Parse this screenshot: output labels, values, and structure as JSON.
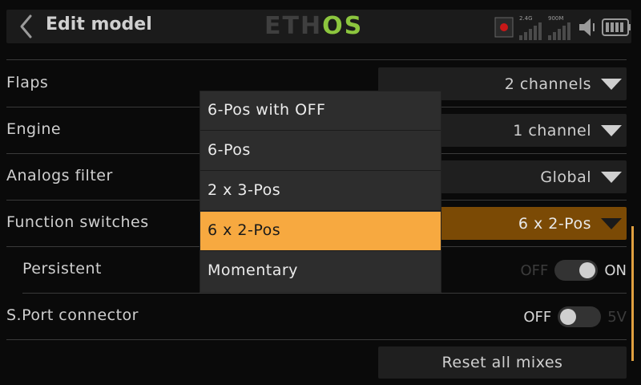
{
  "header": {
    "title": "Edit model",
    "logo_left": "ETH",
    "logo_right": "OS",
    "radio_band": "2.4G",
    "radio_freq": "900M"
  },
  "rows": [
    {
      "label": "Flaps",
      "value": "2 channels"
    },
    {
      "label": "Engine",
      "value": "1 channel"
    },
    {
      "label": "Analogs filter",
      "value": "Global"
    },
    {
      "label": "Function switches",
      "value": "6 x 2-Pos"
    },
    {
      "label": "Persistent",
      "toggle_off": "OFF",
      "toggle_on": "ON",
      "state": "on"
    },
    {
      "label": "S.Port connector",
      "toggle_off": "OFF",
      "toggle_on": "5V",
      "state": "off"
    }
  ],
  "reset_button": "Reset all mixes",
  "dropdown": {
    "options": [
      "6-Pos with OFF",
      "6-Pos",
      "2 x 3-Pos",
      "6 x 2-Pos",
      "Momentary"
    ],
    "selected": "6 x 2-Pos"
  },
  "colors": {
    "accent": "#f7a940",
    "active_select": "#7b4a05",
    "logo_green": "#8cc63e"
  },
  "icons": {
    "back": "chevron-left-icon",
    "record": "record-icon",
    "signal": "signal-bars-icon",
    "volume": "speaker-icon",
    "battery": "battery-icon",
    "dropdown": "caret-down-icon"
  }
}
